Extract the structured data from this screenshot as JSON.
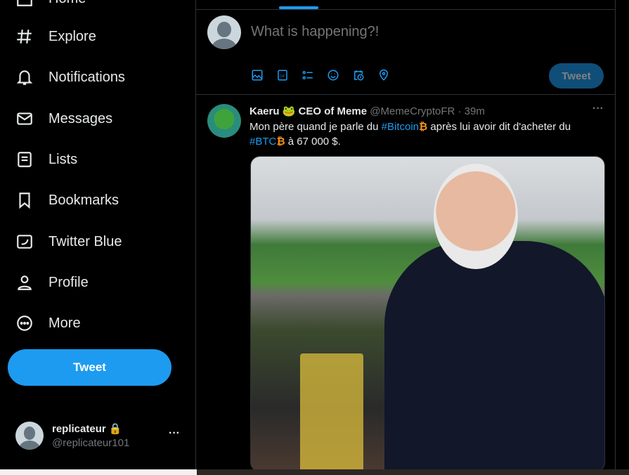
{
  "sidebar": {
    "items": [
      {
        "label": "Home",
        "icon": "home-icon"
      },
      {
        "label": "Explore",
        "icon": "hashtag-icon"
      },
      {
        "label": "Notifications",
        "icon": "bell-icon"
      },
      {
        "label": "Messages",
        "icon": "envelope-icon"
      },
      {
        "label": "Lists",
        "icon": "list-icon"
      },
      {
        "label": "Bookmarks",
        "icon": "bookmark-icon"
      },
      {
        "label": "Twitter Blue",
        "icon": "twitter-blue-icon"
      },
      {
        "label": "Profile",
        "icon": "person-icon"
      },
      {
        "label": "More",
        "icon": "more-circle-icon"
      }
    ],
    "tweet_label": "Tweet",
    "account": {
      "name": "replicateur",
      "handle": "@replicateur101"
    }
  },
  "compose": {
    "placeholder": "What is happening?!",
    "tweet_label": "Tweet",
    "tools": [
      "image-icon",
      "gif-icon",
      "poll-icon",
      "emoji-icon",
      "schedule-icon",
      "location-icon"
    ]
  },
  "tweet": {
    "name_a": "Kaeru",
    "emoji": "🐸",
    "name_b": "CEO of Meme",
    "handle": "@MemeCryptoFR",
    "time": "· 39m",
    "text1": "Mon père quand je parle du ",
    "tag1": "#Bitcoin",
    "text2": "  après lui avoir dit d'acheter du ",
    "tag2": "#BTC",
    "text3": "  à 67 000 $.",
    "btc": "₿"
  },
  "colors": {
    "accent": "#1d9bf0",
    "bitcoin": "#f7931a"
  }
}
